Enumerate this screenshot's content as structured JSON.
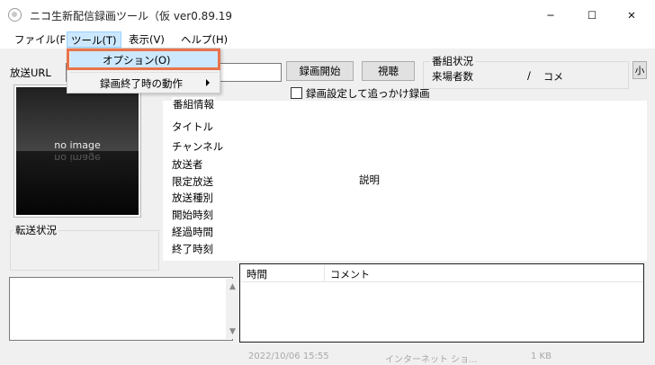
{
  "window": {
    "title": "ニコ生新配信録画ツール（仮 ver0.89.19",
    "minimize": "─",
    "maximize": "☐",
    "close": "✕"
  },
  "menu": {
    "file": "ファイル(F)",
    "tool": "ツール(T)",
    "view": "表示(V)",
    "help": "ヘルプ(H)"
  },
  "dropdown": {
    "options": "オプション(O)",
    "end_action": "録画終了時の動作"
  },
  "url": {
    "label": "放送URL",
    "value": ""
  },
  "buttons": {
    "record_start": "録画開始",
    "view": "視聴",
    "small": "小"
  },
  "status": {
    "title": "番組状況",
    "visitors": "来場者数",
    "slash": "/",
    "comment": "コメ"
  },
  "checkbox": {
    "label": "録画設定して追っかけ録画",
    "checked": false
  },
  "thumbnail": {
    "text": "no image"
  },
  "transfer": {
    "title": "転送状況"
  },
  "info": {
    "title": "番組情報",
    "title_label": "タイトル",
    "channel": "チャンネル",
    "broadcaster": "放送者",
    "limited": "限定放送",
    "kind": "放送種別",
    "start_time": "開始時刻",
    "elapsed": "経過時間",
    "end_time": "終了時刻",
    "description": "説明"
  },
  "comments": {
    "col_time": "時間",
    "col_comment": "コメント"
  },
  "scroll": {
    "up": "▲",
    "down": "▼"
  },
  "background": {
    "date": "2022/10/06 15:55",
    "kind": "インターネット ショ...",
    "size": "1 KB"
  }
}
